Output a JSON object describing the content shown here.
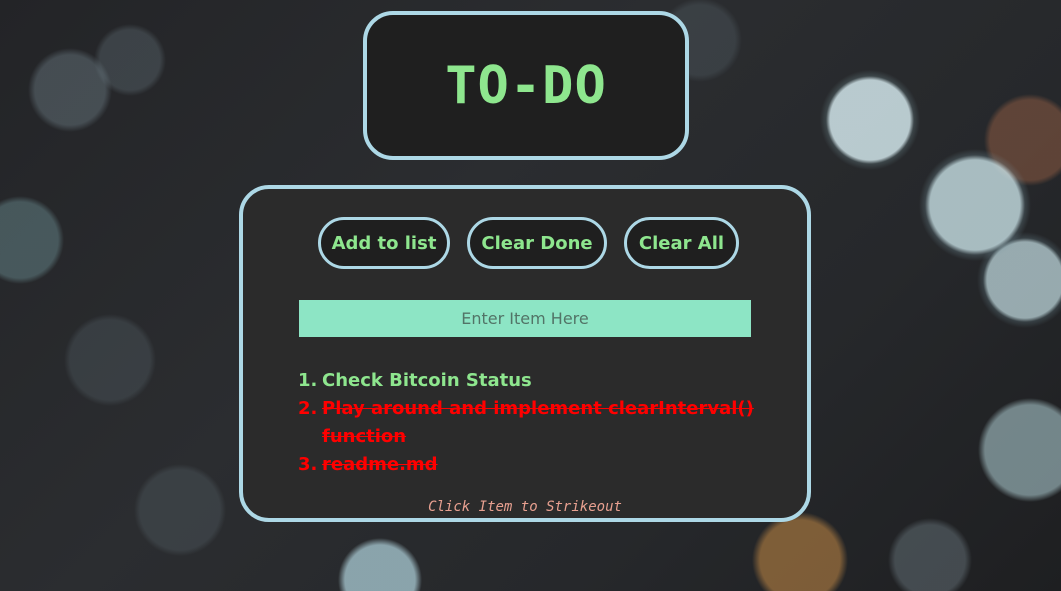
{
  "header": {
    "title": "TO-DO"
  },
  "toolbar": {
    "add_label": "Add to list",
    "clear_done_label": "Clear Done",
    "clear_all_label": "Clear All"
  },
  "input": {
    "placeholder": "Enter Item Here",
    "value": ""
  },
  "items": [
    {
      "number": "1.",
      "text": "Check Bitcoin Status",
      "done": false
    },
    {
      "number": "2.",
      "text": "Play around and implement clearInterval() function",
      "done": true
    },
    {
      "number": "3.",
      "text": "readme.md",
      "done": true
    }
  ],
  "hint": "Click Item to Strikeout",
  "colors": {
    "accent_green": "#8ee68e",
    "border_blue": "#add8e6",
    "done_red": "#ff0000",
    "input_bg": "#8de5c5",
    "hint_color": "#e8a090"
  }
}
